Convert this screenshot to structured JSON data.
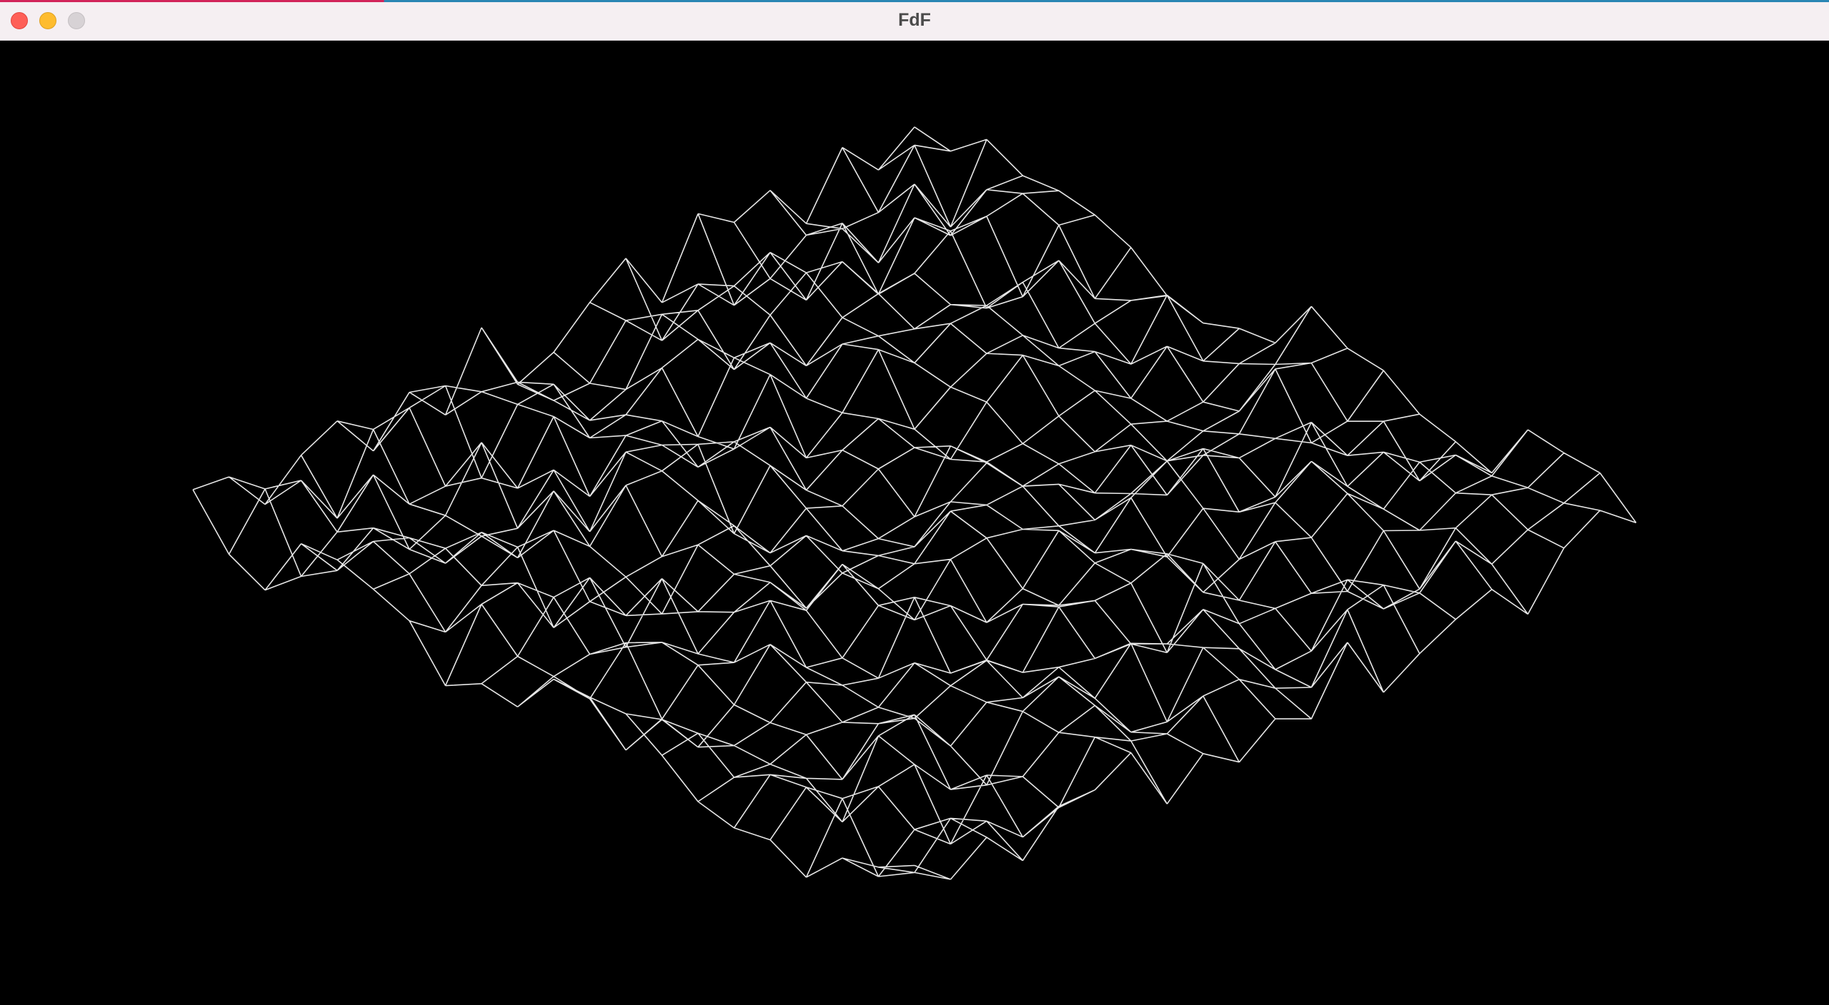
{
  "window": {
    "title": "FdF"
  },
  "titlebar": {
    "buttons": [
      {
        "name": "close",
        "color": "#fe5f57"
      },
      {
        "name": "minimize",
        "color": "#febc2e"
      },
      {
        "name": "zoom",
        "color": "#d7d2d5"
      }
    ]
  },
  "viewport": {
    "background": "#000000",
    "line_color": "#e6e6e6",
    "grid_rows": 20,
    "grid_cols": 20,
    "projection": "isometric"
  }
}
